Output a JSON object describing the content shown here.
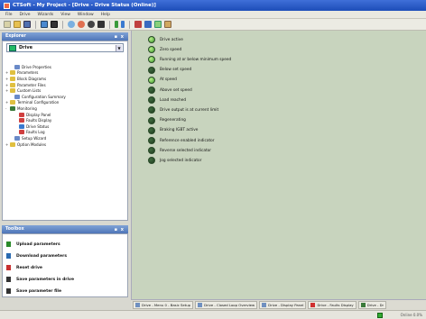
{
  "window": {
    "title": "CTSoft - My Project - [Drive - Drive Status (Online)]"
  },
  "menu": [
    "File",
    "Drive",
    "Wizards",
    "View",
    "Window",
    "Help"
  ],
  "explorer": {
    "header": "Explorer",
    "pin": "▪ x",
    "drive_select": "Drive",
    "tree": [
      {
        "label": "Drive Properties",
        "indent": 1,
        "expander": "",
        "color": "#6a8ac8"
      },
      {
        "label": "Parameters",
        "indent": 0,
        "expander": "+",
        "color": "#e0c040"
      },
      {
        "label": "Block Diagrams",
        "indent": 0,
        "expander": "+",
        "color": "#e0c040"
      },
      {
        "label": "Parameter Files",
        "indent": 0,
        "expander": "+",
        "color": "#e0c040"
      },
      {
        "label": "Custom Lists",
        "indent": 0,
        "expander": "+",
        "color": "#e0c040"
      },
      {
        "label": "Configuration Summary",
        "indent": 1,
        "expander": "",
        "color": "#6a8ac8"
      },
      {
        "label": "Terminal Configuration",
        "indent": 0,
        "expander": "+",
        "color": "#e0c040"
      },
      {
        "label": "Monitoring",
        "indent": 0,
        "expander": "-",
        "color": "#3a7a3a"
      },
      {
        "label": "Display Panel",
        "indent": 2,
        "expander": "",
        "color": "#d04040"
      },
      {
        "label": "Faults Display",
        "indent": 2,
        "expander": "",
        "color": "#d04040"
      },
      {
        "label": "Drive Status",
        "indent": 2,
        "expander": "",
        "color": "#3a7ad0"
      },
      {
        "label": "Faults Log",
        "indent": 2,
        "expander": "",
        "color": "#d04040"
      },
      {
        "label": "Setup Wizard",
        "indent": 1,
        "expander": "",
        "color": "#6a8ac8"
      },
      {
        "label": "Option Modules",
        "indent": 0,
        "expander": "+",
        "color": "#e0c040"
      }
    ]
  },
  "toolbox": {
    "header": "Toolbox",
    "pin": "▪ x",
    "items": [
      {
        "label": "Upload parameters",
        "color": "#2a8a2a"
      },
      {
        "label": "Download parameters",
        "color": "#2a6ab0"
      },
      {
        "label": "Reset drive",
        "color": "#c83030"
      },
      {
        "label": "Save parameters in drive",
        "color": "#333333"
      },
      {
        "label": "Save parameter file",
        "color": "#333333"
      }
    ]
  },
  "status": [
    {
      "label": "Drive active",
      "state": "on"
    },
    {
      "label": "Zero speed",
      "state": "on"
    },
    {
      "label": "Running at or below minimum speed",
      "state": "on"
    },
    {
      "label": "Below set speed",
      "state": "off"
    },
    {
      "label": "At speed",
      "state": "on"
    },
    {
      "label": "Above set speed",
      "state": "off"
    },
    {
      "label": "Load reached",
      "state": "off"
    },
    {
      "label": "Drive output is at current limit",
      "state": "off"
    },
    {
      "label": "Regenerating",
      "state": "off"
    },
    {
      "label": "Braking IGBT active",
      "state": "off"
    },
    {
      "label": "Reference enabled indicator",
      "state": "off"
    },
    {
      "label": "Reverse selected indicator",
      "state": "off"
    },
    {
      "label": "Jog selected indicator",
      "state": "off"
    }
  ],
  "tabs": [
    {
      "label": "Drive - Menu 0 - Basic Setup",
      "color": "#7090c0"
    },
    {
      "label": "Drive - Closed Loop Overview",
      "color": "#7090c0"
    },
    {
      "label": "Drive - Display Panel",
      "color": "#7090c0"
    },
    {
      "label": "Drive - Faults Display",
      "color": "#d03030"
    },
    {
      "label": "Drive - Dr",
      "color": "#3a7a3a"
    }
  ],
  "statusbar": {
    "text": "Online  0.0%"
  }
}
